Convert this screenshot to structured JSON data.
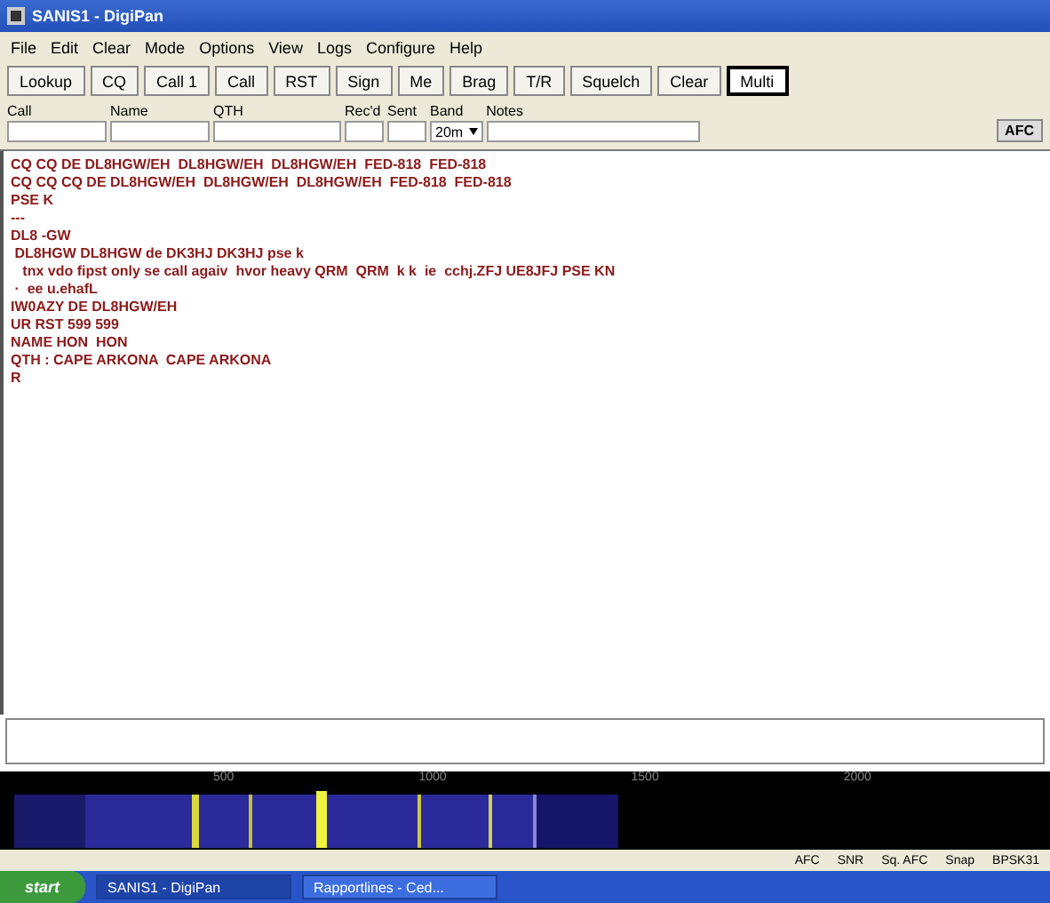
{
  "window": {
    "title": "SANIS1 - DigiPan"
  },
  "menu": [
    "File",
    "Edit",
    "Clear",
    "Mode",
    "Options",
    "View",
    "Logs",
    "Configure",
    "Help"
  ],
  "toolbar": [
    {
      "label": "Lookup",
      "selected": false
    },
    {
      "label": "CQ",
      "selected": false
    },
    {
      "label": "Call 1",
      "selected": false
    },
    {
      "label": "Call",
      "selected": false
    },
    {
      "label": "RST",
      "selected": false
    },
    {
      "label": "Sign",
      "selected": false
    },
    {
      "label": "Me",
      "selected": false
    },
    {
      "label": "Brag",
      "selected": false
    },
    {
      "label": "T/R",
      "selected": false
    },
    {
      "label": "Squelch",
      "selected": false
    },
    {
      "label": "Clear",
      "selected": false
    },
    {
      "label": "Multi",
      "selected": true
    }
  ],
  "log_fields": [
    {
      "label": "Call",
      "kind": "text"
    },
    {
      "label": "Name",
      "kind": "text"
    },
    {
      "label": "QTH",
      "kind": "text"
    },
    {
      "label": "Rec'd",
      "kind": "text"
    },
    {
      "label": "Sent",
      "kind": "text"
    },
    {
      "label": "Band",
      "kind": "select",
      "value": "20m"
    },
    {
      "label": "Notes",
      "kind": "text"
    }
  ],
  "afc_button": "AFC",
  "receive_lines": [
    "CQ CQ DE DL8HGW/EH  DL8HGW/EH  DL8HGW/EH  FED-818  FED-818",
    "CQ CQ CQ DE DL8HGW/EH  DL8HGW/EH  DL8HGW/EH  FED-818  FED-818",
    "PSE K",
    "---",
    "DL8 -GW",
    " DL8HGW DL8HGW de DK3HJ DK3HJ pse k",
    "   tnx vdo fipst only se call agaiv  hvor heavy QRM  QRM  k k  ie  cchj.ZFJ UE8JFJ PSE KN",
    " ·  ee u.ehafL",
    "IW0AZY DE DL8HGW/EH",
    "UR RST 599 599",
    "NAME HON  HON",
    "QTH : CAPE ARKONA  CAPE ARKONA",
    "R"
  ],
  "waterfall": {
    "ticks": [
      "500",
      "1000",
      "1500",
      "2000"
    ]
  },
  "status_bar": [
    "AFC",
    "SNR",
    "Sq. AFC",
    "Snap",
    "BPSK31"
  ],
  "taskbar": {
    "start": "start",
    "tasks": [
      {
        "label": "SANIS1 - DigiPan",
        "selected": true
      },
      {
        "label": "Rapportlines - Ced...",
        "selected": false
      }
    ]
  }
}
